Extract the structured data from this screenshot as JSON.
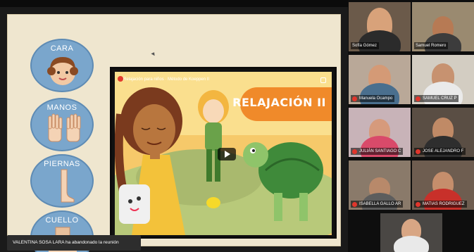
{
  "slide": {
    "categories": [
      {
        "label": "CARA",
        "icon": "face-icon"
      },
      {
        "label": "MANOS",
        "icon": "hands-icon"
      },
      {
        "label": "PIERNAS",
        "icon": "leg-icon"
      },
      {
        "label": "CUELLO",
        "icon": "neck-icon"
      }
    ]
  },
  "video": {
    "title": "Relajación para niños · Método de Koeppen II",
    "banner": "RELAJACIÓN II"
  },
  "notification": {
    "text": "VALENTINA SOSA LARA ha abandonado la reunión"
  },
  "participants": [
    {
      "name": "Sofía Gómez",
      "muted": false
    },
    {
      "name": "Samuel Romero",
      "muted": false
    },
    {
      "name": "Manuela Ocampo",
      "muted": true
    },
    {
      "name": "SAMUEL CRUZ P",
      "muted": true
    },
    {
      "name": "JULIÁN SANTIAGO C",
      "muted": true
    },
    {
      "name": "JOSE ALEJANDRO F",
      "muted": true
    },
    {
      "name": "ISABELLA GALLO AR",
      "muted": true
    },
    {
      "name": "MATIAS RODRIGUEZ",
      "muted": true
    },
    {
      "name": "",
      "muted": false
    }
  ],
  "colors": {
    "slide_bg": "#efe6cf",
    "circle": "#7aa6cc",
    "banner": "#f08a2a",
    "video_bg": "#f2c35a",
    "muted_icon": "#e0362c"
  }
}
